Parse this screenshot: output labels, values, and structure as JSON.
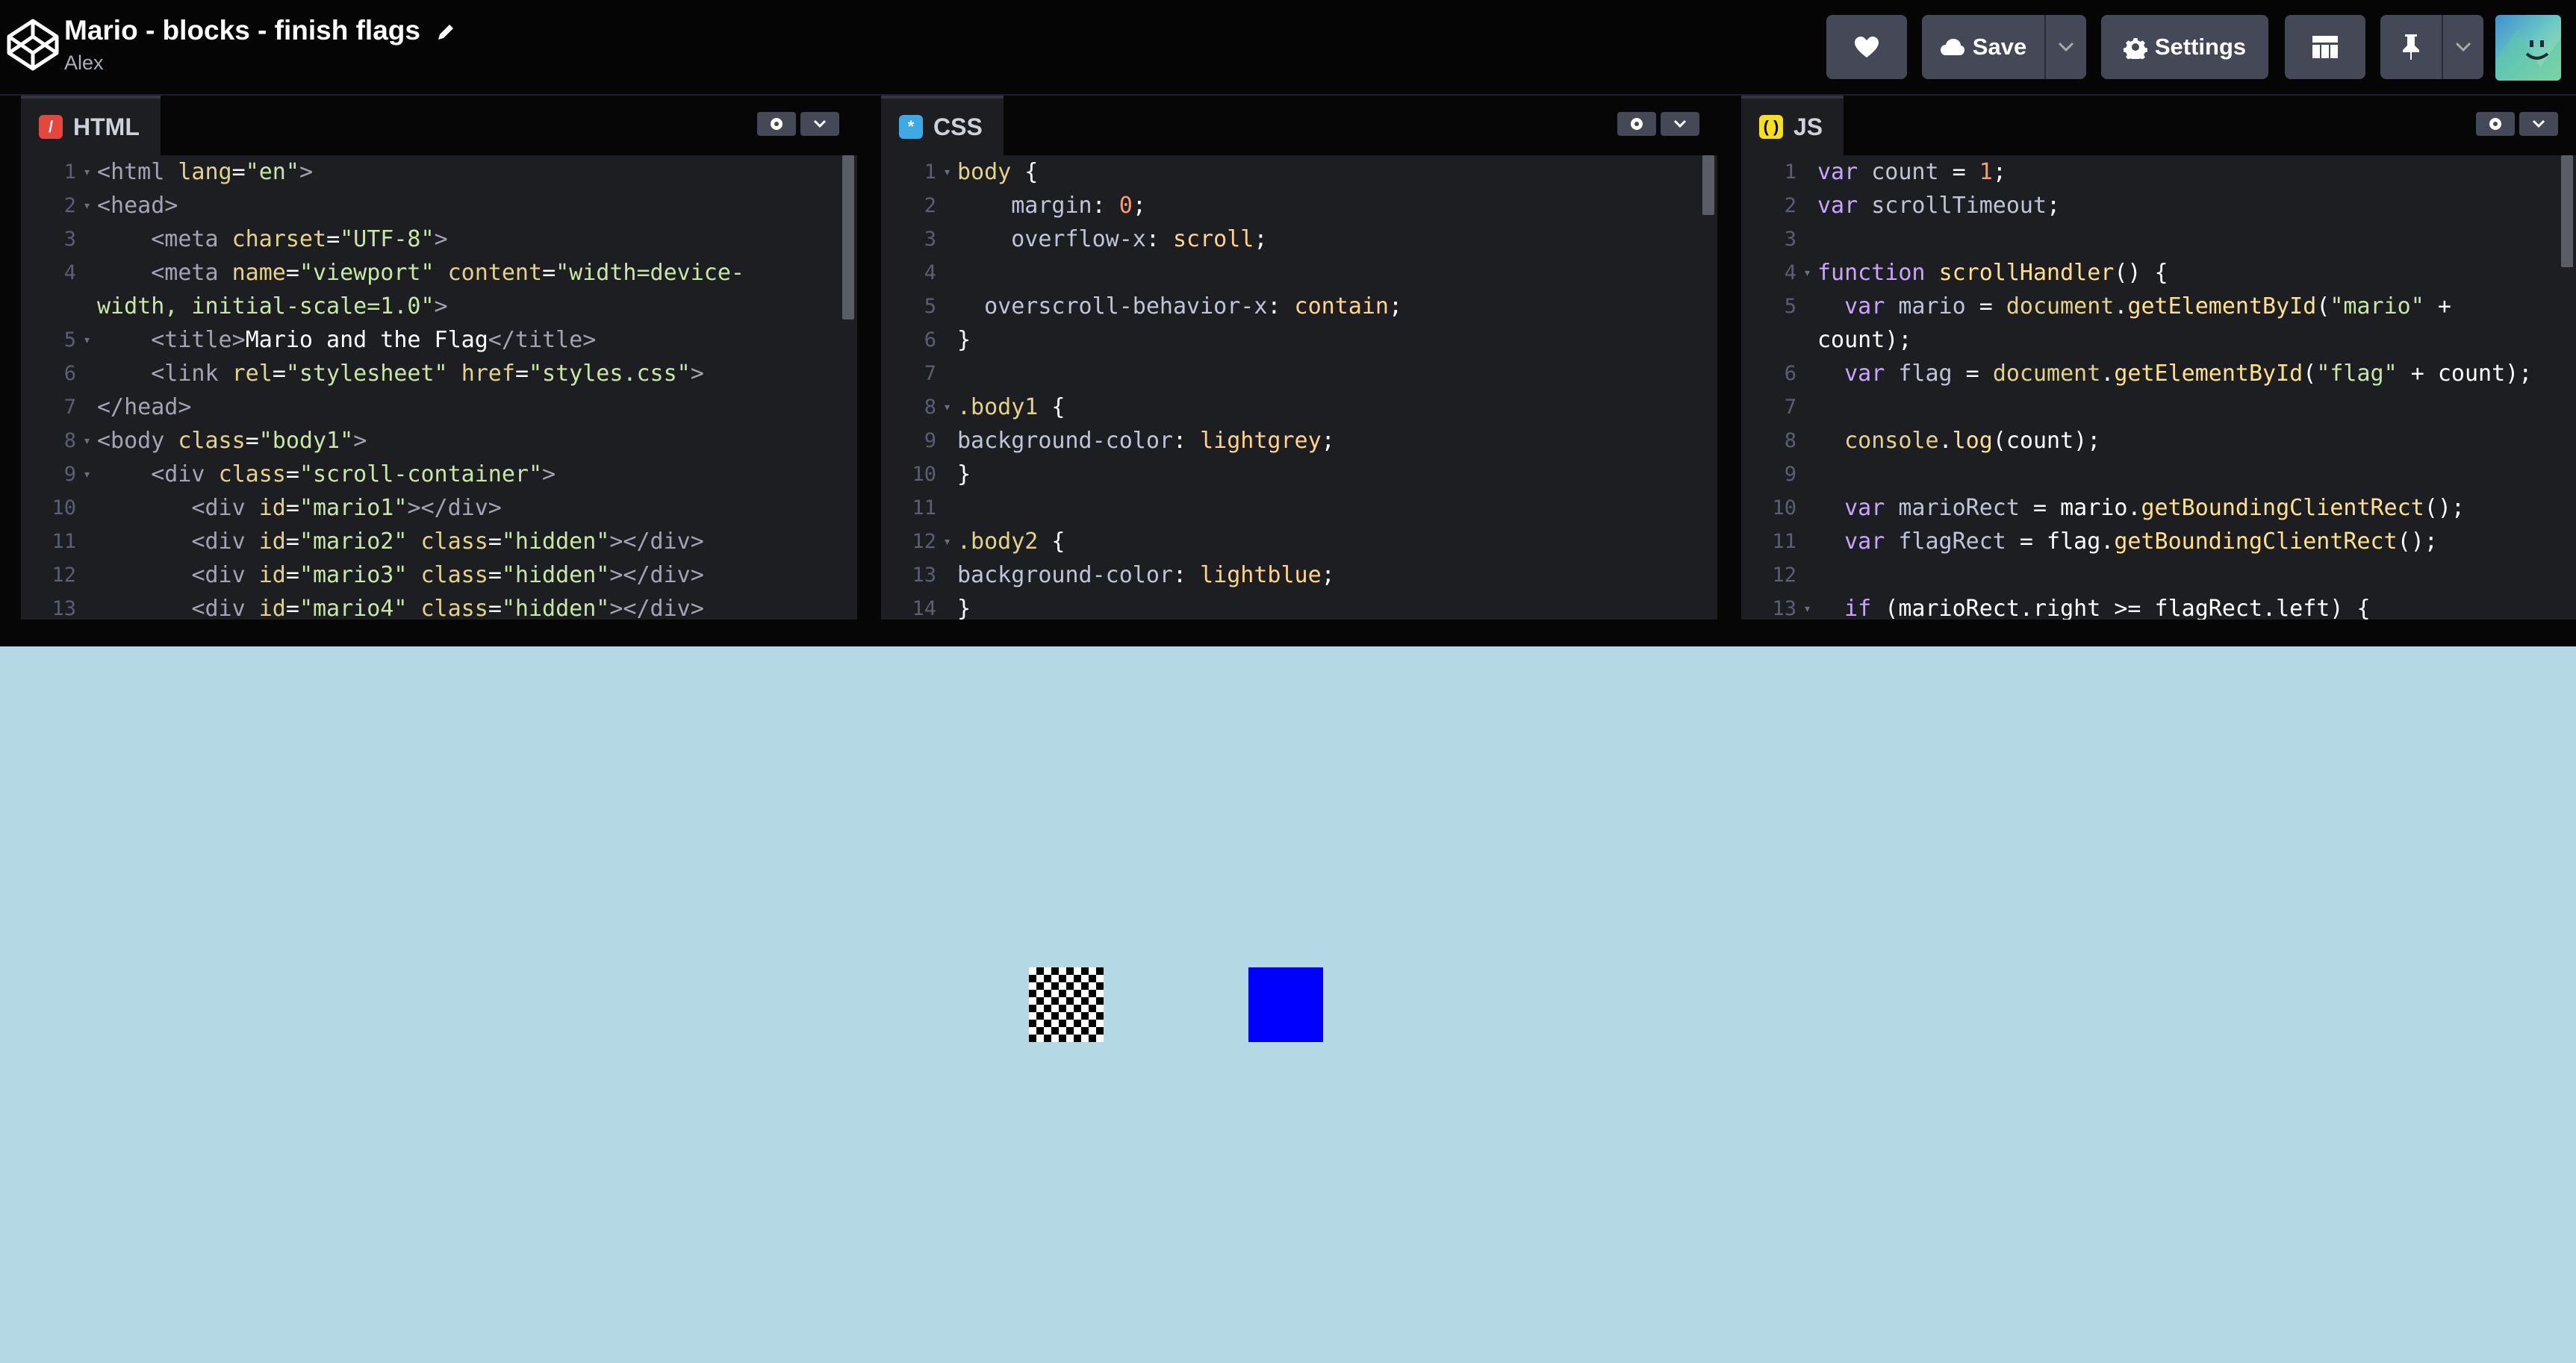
{
  "header": {
    "title": "Mario - blocks - finish flags",
    "author": "Alex",
    "save_label": "Save",
    "settings_label": "Settings"
  },
  "panes": {
    "html": {
      "label": "HTML",
      "lines": [
        {
          "n": "1",
          "fold": true,
          "segs": [
            [
              "tag",
              "<"
            ],
            [
              "tag",
              "html "
            ],
            [
              "a",
              "lang"
            ],
            [
              "v",
              "="
            ],
            [
              "str",
              "\"en\""
            ],
            [
              "tag",
              ">"
            ]
          ]
        },
        {
          "n": "2",
          "fold": true,
          "segs": [
            [
              "tag",
              "<head>"
            ]
          ]
        },
        {
          "n": "3",
          "segs": [
            [
              "v",
              "    "
            ],
            [
              "tag",
              "<meta "
            ],
            [
              "a",
              "charset"
            ],
            [
              "v",
              "="
            ],
            [
              "str",
              "\"UTF-8\""
            ],
            [
              "tag",
              ">"
            ]
          ]
        },
        {
          "n": "4",
          "wrap": true,
          "segs": [
            [
              "v",
              "    "
            ],
            [
              "tag",
              "<meta "
            ],
            [
              "a",
              "name"
            ],
            [
              "v",
              "="
            ],
            [
              "str",
              "\"viewport\""
            ],
            [
              "v",
              " "
            ],
            [
              "a",
              "content"
            ],
            [
              "v",
              "="
            ],
            [
              "str",
              "\"width=device-\nwidth, initial-scale=1.0\""
            ],
            [
              "tag",
              ">"
            ]
          ]
        },
        {
          "n": "5",
          "fold": true,
          "segs": [
            [
              "v",
              "    "
            ],
            [
              "tag",
              "<title>"
            ],
            [
              "v",
              "Mario and the Flag"
            ],
            [
              "tag",
              "</title>"
            ]
          ]
        },
        {
          "n": "6",
          "segs": [
            [
              "v",
              "    "
            ],
            [
              "tag",
              "<link "
            ],
            [
              "a",
              "rel"
            ],
            [
              "v",
              "="
            ],
            [
              "str",
              "\"stylesheet\""
            ],
            [
              "v",
              " "
            ],
            [
              "a",
              "href"
            ],
            [
              "v",
              "="
            ],
            [
              "str",
              "\"styles.css\""
            ],
            [
              "tag",
              ">"
            ]
          ]
        },
        {
          "n": "7",
          "segs": [
            [
              "tag",
              "</head>"
            ]
          ]
        },
        {
          "n": "8",
          "fold": true,
          "segs": [
            [
              "tag",
              "<body "
            ],
            [
              "a",
              "class"
            ],
            [
              "v",
              "="
            ],
            [
              "str",
              "\"body1\""
            ],
            [
              "tag",
              ">"
            ]
          ]
        },
        {
          "n": "9",
          "fold": true,
          "segs": [
            [
              "v",
              "    "
            ],
            [
              "tag",
              "<div "
            ],
            [
              "a",
              "class"
            ],
            [
              "v",
              "="
            ],
            [
              "str",
              "\"scroll-container\""
            ],
            [
              "tag",
              ">"
            ]
          ]
        },
        {
          "n": "10",
          "segs": [
            [
              "v",
              "       "
            ],
            [
              "tag",
              "<div "
            ],
            [
              "a",
              "id"
            ],
            [
              "v",
              "="
            ],
            [
              "str",
              "\"mario1\""
            ],
            [
              "tag",
              "></div>"
            ]
          ]
        },
        {
          "n": "11",
          "segs": [
            [
              "v",
              "       "
            ],
            [
              "tag",
              "<div "
            ],
            [
              "a",
              "id"
            ],
            [
              "v",
              "="
            ],
            [
              "str",
              "\"mario2\""
            ],
            [
              "v",
              " "
            ],
            [
              "a",
              "class"
            ],
            [
              "v",
              "="
            ],
            [
              "str",
              "\"hidden\""
            ],
            [
              "tag",
              "></div>"
            ]
          ]
        },
        {
          "n": "12",
          "segs": [
            [
              "v",
              "       "
            ],
            [
              "tag",
              "<div "
            ],
            [
              "a",
              "id"
            ],
            [
              "v",
              "="
            ],
            [
              "str",
              "\"mario3\""
            ],
            [
              "v",
              " "
            ],
            [
              "a",
              "class"
            ],
            [
              "v",
              "="
            ],
            [
              "str",
              "\"hidden\""
            ],
            [
              "tag",
              "></div>"
            ]
          ]
        },
        {
          "n": "13",
          "segs": [
            [
              "v",
              "       "
            ],
            [
              "tag",
              "<div "
            ],
            [
              "a",
              "id"
            ],
            [
              "v",
              "="
            ],
            [
              "str",
              "\"mario4\""
            ],
            [
              "v",
              " "
            ],
            [
              "a",
              "class"
            ],
            [
              "v",
              "="
            ],
            [
              "str",
              "\"hidden\""
            ],
            [
              "tag",
              "></div>"
            ]
          ]
        }
      ]
    },
    "css": {
      "label": "CSS",
      "lines": [
        {
          "n": "1",
          "fold": true,
          "segs": [
            [
              "a",
              "body"
            ],
            [
              "v",
              " {"
            ]
          ]
        },
        {
          "n": "2",
          "segs": [
            [
              "v",
              "    "
            ],
            [
              "prop",
              "margin"
            ],
            [
              "v",
              ": "
            ],
            [
              "num",
              "0"
            ],
            [
              "v",
              ";"
            ]
          ]
        },
        {
          "n": "3",
          "segs": [
            [
              "v",
              "    "
            ],
            [
              "prop",
              "overflow-x"
            ],
            [
              "v",
              ": "
            ],
            [
              "val",
              "scroll"
            ],
            [
              "v",
              ";"
            ]
          ]
        },
        {
          "n": "4",
          "segs": [
            [
              "v",
              ""
            ]
          ]
        },
        {
          "n": "5",
          "segs": [
            [
              "v",
              "  "
            ],
            [
              "prop",
              "overscroll-behavior-x"
            ],
            [
              "v",
              ": "
            ],
            [
              "val",
              "contain"
            ],
            [
              "v",
              ";"
            ]
          ]
        },
        {
          "n": "6",
          "segs": [
            [
              "v",
              "}"
            ]
          ]
        },
        {
          "n": "7",
          "segs": [
            [
              "v",
              ""
            ]
          ]
        },
        {
          "n": "8",
          "fold": true,
          "segs": [
            [
              "a",
              ".body1"
            ],
            [
              "v",
              " {"
            ]
          ]
        },
        {
          "n": "9",
          "segs": [
            [
              "prop",
              "background-color"
            ],
            [
              "v",
              ": "
            ],
            [
              "val",
              "lightgrey"
            ],
            [
              "v",
              ";"
            ]
          ]
        },
        {
          "n": "10",
          "segs": [
            [
              "v",
              "}"
            ]
          ]
        },
        {
          "n": "11",
          "segs": [
            [
              "v",
              ""
            ]
          ]
        },
        {
          "n": "12",
          "fold": true,
          "segs": [
            [
              "a",
              ".body2"
            ],
            [
              "v",
              " {"
            ]
          ]
        },
        {
          "n": "13",
          "segs": [
            [
              "prop",
              "background-color"
            ],
            [
              "v",
              ": "
            ],
            [
              "val",
              "lightblue"
            ],
            [
              "v",
              ";"
            ]
          ]
        },
        {
          "n": "14",
          "segs": [
            [
              "v",
              "}"
            ]
          ]
        }
      ]
    },
    "js": {
      "label": "JS",
      "lines": [
        {
          "n": "1",
          "segs": [
            [
              "kw",
              "var"
            ],
            [
              "v",
              " "
            ],
            [
              "prop",
              "count"
            ],
            [
              "v",
              " = "
            ],
            [
              "num",
              "1"
            ],
            [
              "v",
              ";"
            ]
          ]
        },
        {
          "n": "2",
          "segs": [
            [
              "kw",
              "var"
            ],
            [
              "v",
              " "
            ],
            [
              "prop",
              "scrollTimeout"
            ],
            [
              "v",
              ";"
            ]
          ]
        },
        {
          "n": "3",
          "segs": [
            [
              "v",
              ""
            ]
          ]
        },
        {
          "n": "4",
          "fold": true,
          "segs": [
            [
              "kw",
              "function"
            ],
            [
              "v",
              " "
            ],
            [
              "fn",
              "scrollHandler"
            ],
            [
              "v",
              "() {"
            ]
          ]
        },
        {
          "n": "5",
          "wrap": true,
          "segs": [
            [
              "v",
              "  "
            ],
            [
              "kw",
              "var"
            ],
            [
              "v",
              " "
            ],
            [
              "prop",
              "mario"
            ],
            [
              "v",
              " = "
            ],
            [
              "a",
              "document"
            ],
            [
              "v",
              "."
            ],
            [
              "fn",
              "getElementById"
            ],
            [
              "v",
              "("
            ],
            [
              "str",
              "\"mario\""
            ],
            [
              "v",
              " +\ncount);"
            ]
          ]
        },
        {
          "n": "6",
          "segs": [
            [
              "v",
              "  "
            ],
            [
              "kw",
              "var"
            ],
            [
              "v",
              " "
            ],
            [
              "prop",
              "flag"
            ],
            [
              "v",
              " = "
            ],
            [
              "a",
              "document"
            ],
            [
              "v",
              "."
            ],
            [
              "fn",
              "getElementById"
            ],
            [
              "v",
              "("
            ],
            [
              "str",
              "\"flag\""
            ],
            [
              "v",
              " + count);"
            ]
          ]
        },
        {
          "n": "7",
          "segs": [
            [
              "v",
              ""
            ]
          ]
        },
        {
          "n": "8",
          "segs": [
            [
              "v",
              "  "
            ],
            [
              "a",
              "console"
            ],
            [
              "v",
              "."
            ],
            [
              "fn",
              "log"
            ],
            [
              "v",
              "(count);"
            ]
          ]
        },
        {
          "n": "9",
          "segs": [
            [
              "v",
              ""
            ]
          ]
        },
        {
          "n": "10",
          "segs": [
            [
              "v",
              "  "
            ],
            [
              "kw",
              "var"
            ],
            [
              "v",
              " "
            ],
            [
              "prop",
              "marioRect"
            ],
            [
              "v",
              " = mario."
            ],
            [
              "fn",
              "getBoundingClientRect"
            ],
            [
              "v",
              "();"
            ]
          ]
        },
        {
          "n": "11",
          "segs": [
            [
              "v",
              "  "
            ],
            [
              "kw",
              "var"
            ],
            [
              "v",
              " "
            ],
            [
              "prop",
              "flagRect"
            ],
            [
              "v",
              " = flag."
            ],
            [
              "fn",
              "getBoundingClientRect"
            ],
            [
              "v",
              "();"
            ]
          ]
        },
        {
          "n": "12",
          "segs": [
            [
              "v",
              ""
            ]
          ]
        },
        {
          "n": "13",
          "fold": true,
          "segs": [
            [
              "v",
              "  "
            ],
            [
              "kw",
              "if"
            ],
            [
              "v",
              " (marioRect.right >= flagRect.left) {"
            ]
          ]
        }
      ]
    }
  },
  "preview": {
    "background": "#b4d8e4",
    "flag_name": "checkered-flag",
    "mario_color": "#0000ff"
  }
}
